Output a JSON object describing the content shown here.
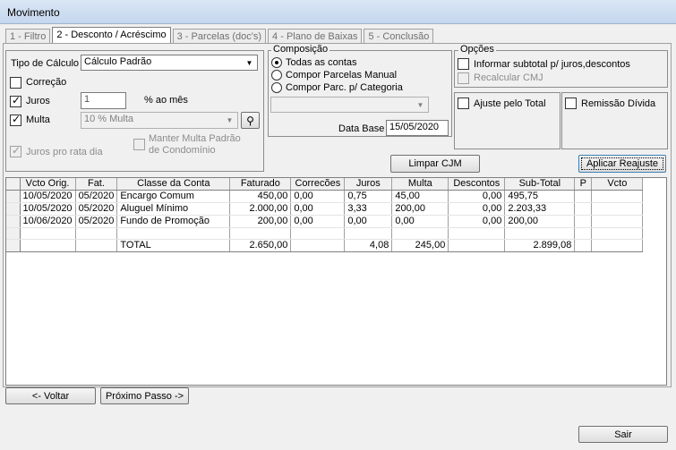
{
  "window": {
    "title": "Movimento"
  },
  "tabs": [
    {
      "label": "1 - Filtro"
    },
    {
      "label": "2 - Desconto / Acréscimo"
    },
    {
      "label": "3 - Parcelas (doc's)"
    },
    {
      "label": "4 - Plano de Baixas"
    },
    {
      "label": "5 - Conclusão"
    }
  ],
  "calc": {
    "tipo_label": "Tipo de Cálculo",
    "tipo_value": "Cálculo Padrão",
    "correcao_label": "Correção",
    "correcao_checked": false,
    "juros_label": "Juros",
    "juros_checked": true,
    "juros_value": "1",
    "juros_unit": "% ao mês",
    "multa_label": "Multa",
    "multa_checked": true,
    "multa_value": "10 % Multa",
    "juros_pro_rata_label": "Juros pro rata dia",
    "manter_multa_label_1": "Manter Multa Padrão",
    "manter_multa_label_2": "de Condomínio"
  },
  "composicao": {
    "legend": "Composição",
    "options": [
      "Todas as contas",
      "Compor Parcelas Manual",
      "Compor Parc. p/ Categoria"
    ],
    "selected_index": 0,
    "data_base_label": "Data Base",
    "data_base_value": "15/05/2020"
  },
  "opcoes": {
    "legend": "Opções",
    "informar_label": "Informar subtotal p/ juros,descontos",
    "recalcular_label": "Recalcular CMJ",
    "ajuste_label": "Ajuste pelo Total",
    "remissao_label": "Remissão Dívida"
  },
  "buttons": {
    "limpar_cjm": "Limpar CJM",
    "aplicar_reajuste": "Aplicar Reajuste",
    "voltar": "<- Voltar",
    "proximo": "Próximo Passo ->",
    "sair": "Sair"
  },
  "grid": {
    "headers": [
      "Vcto Orig.",
      "Fat.",
      "Classe da Conta",
      "Faturado",
      "Correcões",
      "Juros",
      "Multa",
      "Descontos",
      "Sub-Total",
      "P",
      "Vcto"
    ],
    "rows": [
      [
        "10/05/2020",
        "05/2020",
        "Encargo Comum",
        "450,00",
        "0,00",
        "0,75",
        "45,00",
        "0,00",
        "495,75",
        "",
        ""
      ],
      [
        "10/05/2020",
        "05/2020",
        "Aluguel Mínimo",
        "2.000,00",
        "0,00",
        "3,33",
        "200,00",
        "0,00",
        "2.203,33",
        "",
        ""
      ],
      [
        "10/06/2020",
        "05/2020",
        "Fundo de Promoção",
        "200,00",
        "0,00",
        "0,00",
        "0,00",
        "0,00",
        "200,00",
        "",
        ""
      ],
      [
        "",
        "",
        "",
        "",
        "",
        "",
        "",
        "",
        "",
        "",
        ""
      ]
    ],
    "total": [
      "",
      "",
      "TOTAL",
      "2.650,00",
      "",
      "4,08",
      "245,00",
      "",
      "2.899,08",
      "",
      ""
    ]
  }
}
